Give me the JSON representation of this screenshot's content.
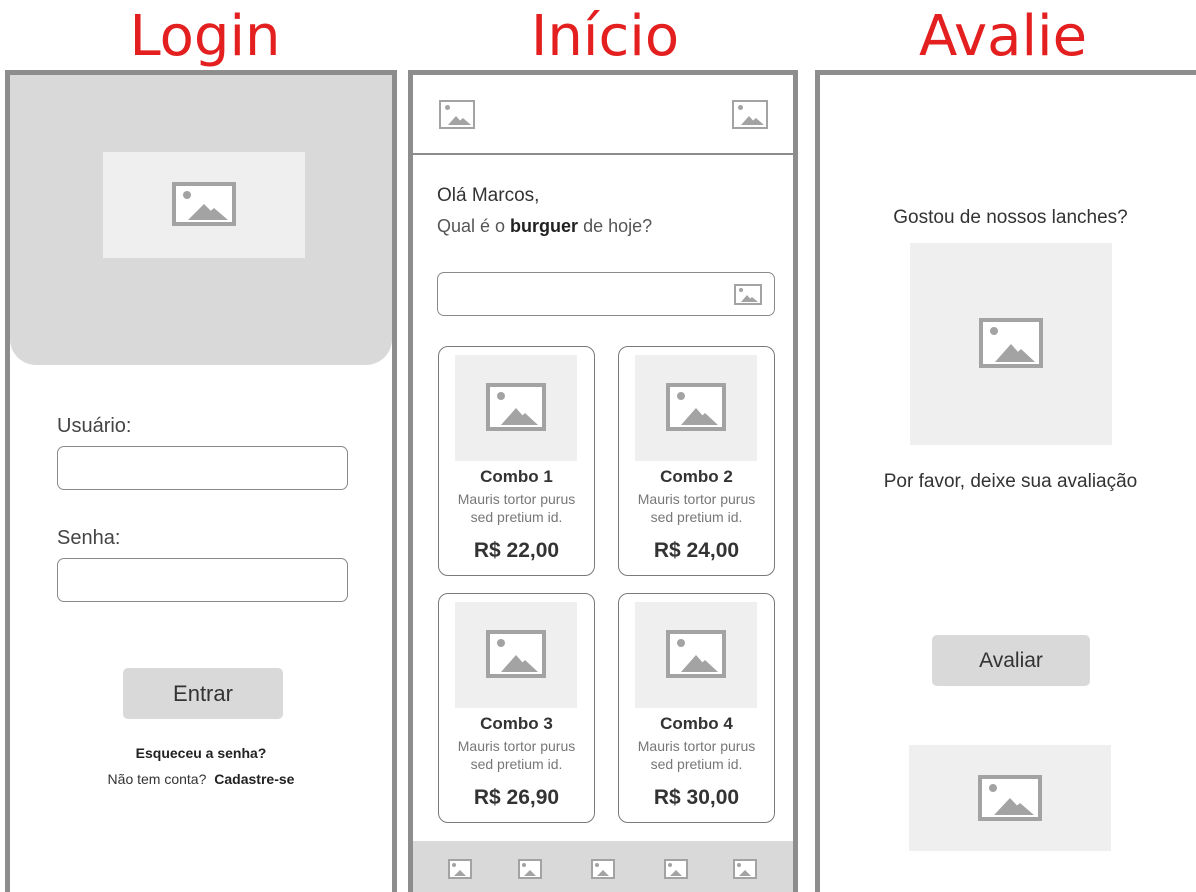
{
  "titles": {
    "login": "Login",
    "home": "Início",
    "rate": "Avalie"
  },
  "login": {
    "user_label": "Usuário:",
    "user_value": "",
    "password_label": "Senha:",
    "password_value": "",
    "submit_label": "Entrar",
    "forgot_label": "Esqueceu a senha?",
    "no_account_text": "Não tem conta?",
    "signup_label": "Cadastre-se"
  },
  "home": {
    "greeting": "Olá Marcos,",
    "question_before": "Qual é o ",
    "question_bold": "burguer",
    "question_after": " de hoje?",
    "search_value": "",
    "products": [
      {
        "name": "Combo 1",
        "desc_line1": "Mauris tortor purus",
        "desc_line2": "sed pretium id.",
        "price": "R$ 22,00"
      },
      {
        "name": "Combo 2",
        "desc_line1": "Mauris tortor purus",
        "desc_line2": "sed pretium id.",
        "price": "R$ 24,00"
      },
      {
        "name": "Combo 3",
        "desc_line1": "Mauris tortor purus",
        "desc_line2": "sed pretium id.",
        "price": "R$ 26,90"
      },
      {
        "name": "Combo 4",
        "desc_line1": "Mauris tortor purus",
        "desc_line2": "sed pretium id.",
        "price": "R$ 30,00"
      }
    ]
  },
  "rate": {
    "question": "Gostou de nossos lanches?",
    "prompt": "Por favor, deixe sua avaliação",
    "submit_label": "Avaliar"
  },
  "colors": {
    "title": "#e3201f",
    "frame": "#8d8d8d",
    "placeholder": "#a3a3a3",
    "panel": "#d9d9d9"
  }
}
